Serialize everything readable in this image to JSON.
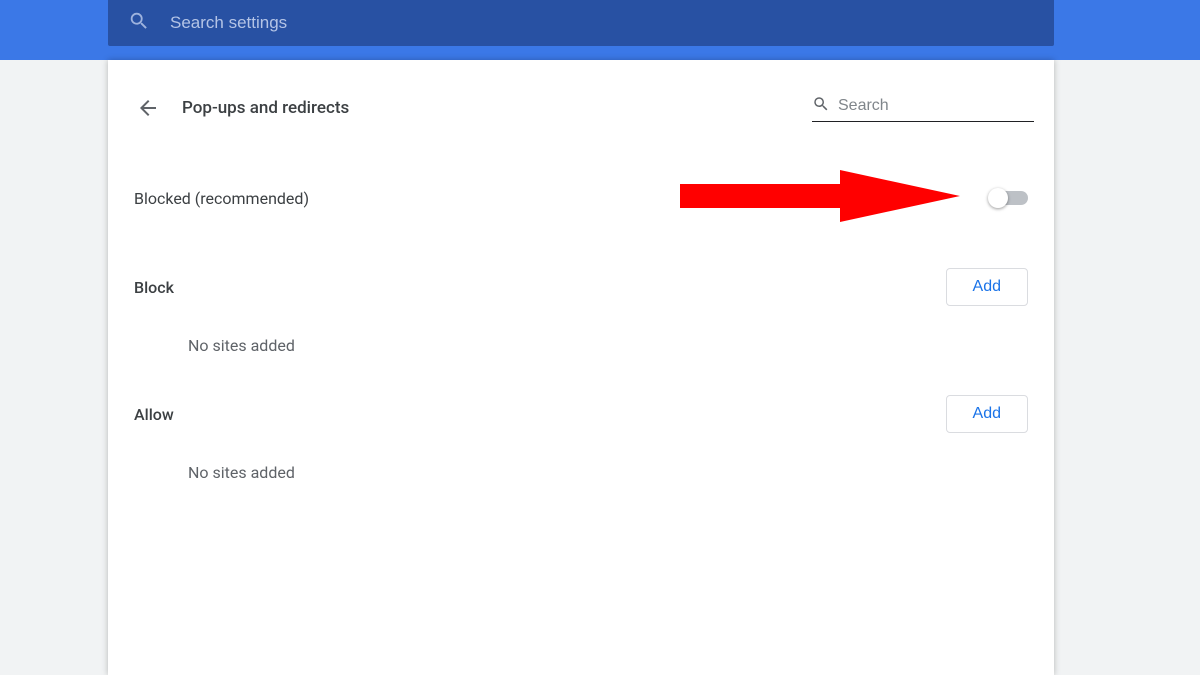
{
  "topSearch": {
    "placeholder": "Search settings"
  },
  "header": {
    "title": "Pop-ups and redirects",
    "searchPlaceholder": "Search"
  },
  "toggle": {
    "label": "Blocked (recommended)",
    "enabled": false
  },
  "sections": {
    "block": {
      "title": "Block",
      "addLabel": "Add",
      "empty": "No sites added"
    },
    "allow": {
      "title": "Allow",
      "addLabel": "Add",
      "empty": "No sites added"
    }
  },
  "colors": {
    "accent": "#1a73e8",
    "headerBg": "#3b78e7",
    "searchBg": "#2851a3"
  }
}
